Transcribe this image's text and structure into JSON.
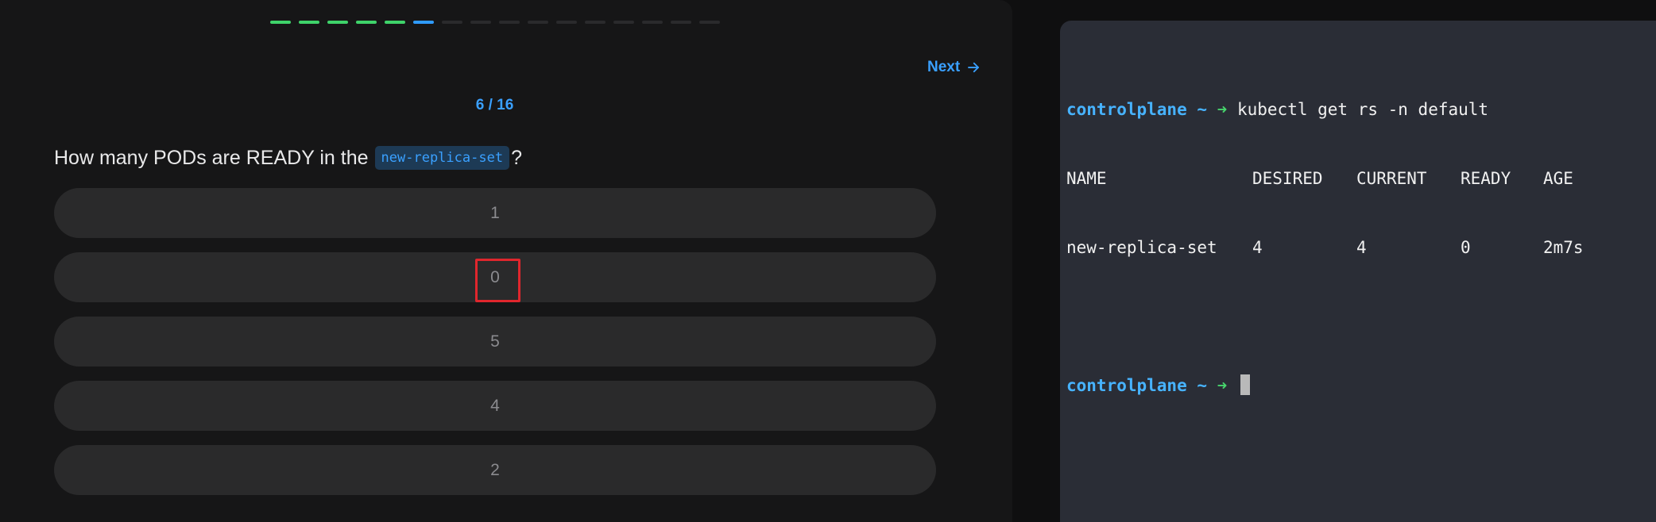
{
  "quiz": {
    "progress": {
      "total": 16,
      "done": 5,
      "current": 6
    },
    "next_label": "Next",
    "counter": "6 / 16",
    "question": {
      "prefix": "How many PODs are READY in the",
      "code": "new-replica-set",
      "suffix": "?"
    },
    "options": [
      "1",
      "0",
      "5",
      "4",
      "2"
    ]
  },
  "terminal": {
    "prompt_host": "controlplane ~",
    "prompt_arrow": "➜",
    "command": "kubectl get rs -n default",
    "headers": [
      "NAME",
      "DESIRED",
      "CURRENT",
      "READY",
      "AGE"
    ],
    "rows": [
      [
        "new-replica-set",
        "4",
        "4",
        "0",
        "2m7s"
      ]
    ]
  },
  "colors": {
    "done": "#3fd36a",
    "current": "#2f9bff",
    "accent": "#3aa0ff",
    "highlight": "#e0262d"
  }
}
